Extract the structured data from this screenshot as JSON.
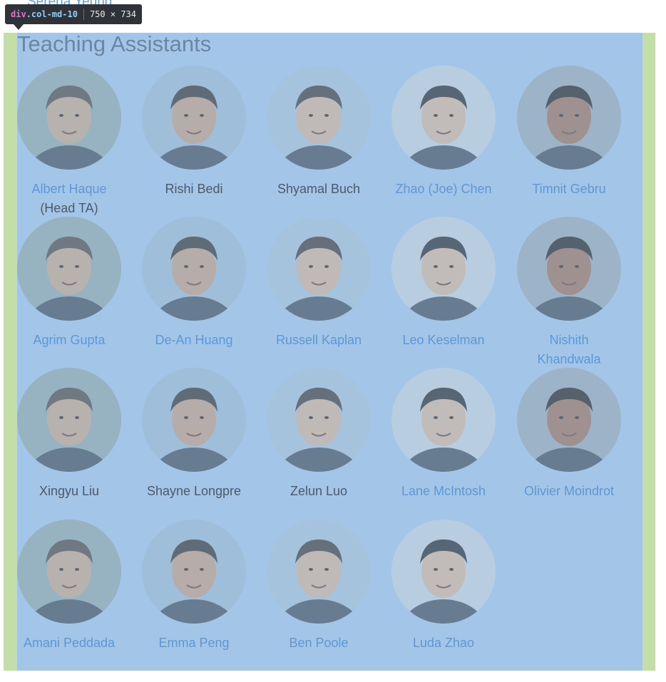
{
  "prev_name": "Serena Yeung",
  "inspector": {
    "selector_tag": "div",
    "selector_class": ".col-md-10",
    "dimensions": "750 × 734"
  },
  "section": {
    "title": "Teaching Assistants"
  },
  "colors": {
    "link": "#5c97d6",
    "plain": "#4e5966",
    "overlay_content": "#a3c6e8",
    "overlay_padding": "#c3dfa7"
  },
  "people": [
    {
      "name": "Albert Haque",
      "role": "(Head TA)",
      "link": true,
      "photo": "portrait-photo"
    },
    {
      "name": "Rishi Bedi",
      "role": "",
      "link": false,
      "photo": "portrait-photo"
    },
    {
      "name": "Shyamal Buch",
      "role": "",
      "link": false,
      "photo": "portrait-photo"
    },
    {
      "name": "Zhao (Joe) Chen",
      "role": "",
      "link": true,
      "photo": "portrait-photo"
    },
    {
      "name": "Timnit Gebru",
      "role": "",
      "link": true,
      "photo": "portrait-photo"
    },
    {
      "name": "Agrim Gupta",
      "role": "",
      "link": true,
      "photo": "portrait-photo"
    },
    {
      "name": "De-An Huang",
      "role": "",
      "link": true,
      "photo": "portrait-photo"
    },
    {
      "name": "Russell Kaplan",
      "role": "",
      "link": true,
      "photo": "portrait-photo"
    },
    {
      "name": "Leo Keselman",
      "role": "",
      "link": true,
      "photo": "portrait-photo"
    },
    {
      "name": "Nishith Khandwala",
      "role": "",
      "link": true,
      "photo": "portrait-photo"
    },
    {
      "name": "Xingyu Liu",
      "role": "",
      "link": false,
      "photo": "portrait-photo"
    },
    {
      "name": "Shayne Longpre",
      "role": "",
      "link": false,
      "photo": "portrait-photo"
    },
    {
      "name": "Zelun Luo",
      "role": "",
      "link": false,
      "photo": "portrait-photo"
    },
    {
      "name": "Lane McIntosh",
      "role": "",
      "link": true,
      "photo": "portrait-photo"
    },
    {
      "name": "Olivier Moindrot",
      "role": "",
      "link": true,
      "photo": "portrait-photo"
    },
    {
      "name": "Amani Peddada",
      "role": "",
      "link": true,
      "photo": "portrait-photo"
    },
    {
      "name": "Emma Peng",
      "role": "",
      "link": true,
      "photo": "portrait-photo"
    },
    {
      "name": "Ben Poole",
      "role": "",
      "link": true,
      "photo": "portrait-photo"
    },
    {
      "name": "Luda Zhao",
      "role": "",
      "link": true,
      "photo": "portrait-photo"
    }
  ]
}
